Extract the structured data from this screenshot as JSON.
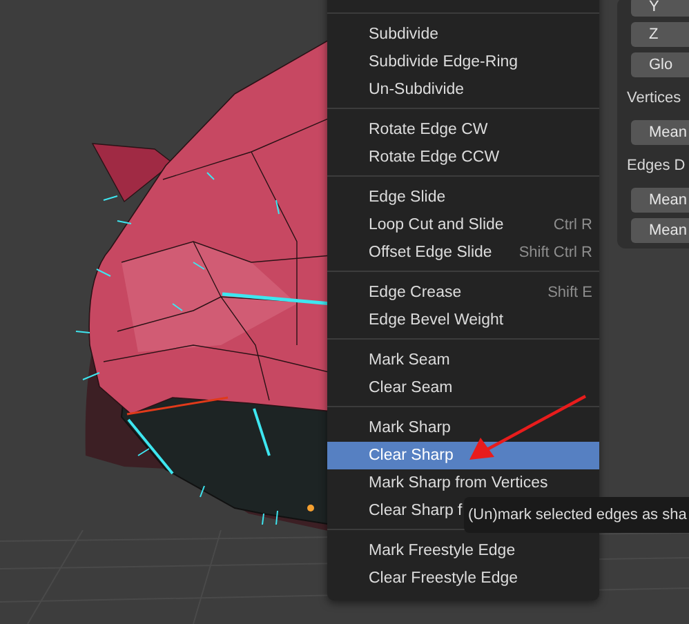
{
  "menu": {
    "sections": [
      {
        "items": [
          {
            "label": "Subdivide",
            "selected": false
          },
          {
            "label": "Subdivide Edge-Ring",
            "selected": false
          },
          {
            "label": "Un-Subdivide",
            "selected": false
          }
        ]
      },
      {
        "items": [
          {
            "label": "Rotate Edge CW",
            "selected": false
          },
          {
            "label": "Rotate Edge CCW",
            "selected": false
          }
        ]
      },
      {
        "items": [
          {
            "label": "Edge Slide",
            "selected": false
          },
          {
            "label": "Loop Cut and Slide",
            "shortcut": "Ctrl R",
            "selected": false
          },
          {
            "label": "Offset Edge Slide",
            "shortcut": "Shift Ctrl R",
            "selected": false
          }
        ]
      },
      {
        "items": [
          {
            "label": "Edge Crease",
            "shortcut": "Shift E",
            "selected": false
          },
          {
            "label": "Edge Bevel Weight",
            "selected": false
          }
        ]
      },
      {
        "items": [
          {
            "label": "Mark Seam",
            "selected": false
          },
          {
            "label": "Clear Seam",
            "selected": false
          }
        ]
      },
      {
        "items": [
          {
            "label": "Mark Sharp",
            "selected": false
          },
          {
            "label": "Clear Sharp",
            "selected": true
          },
          {
            "label": "Mark Sharp from Vertices",
            "selected": false
          },
          {
            "label": "Clear Sharp f",
            "selected": false
          }
        ]
      },
      {
        "items": [
          {
            "label": "Mark Freestyle Edge",
            "selected": false
          },
          {
            "label": "Clear Freestyle Edge",
            "selected": false
          }
        ]
      }
    ]
  },
  "tooltip": {
    "text": "(Un)mark selected edges as sha"
  },
  "side_panel": {
    "items": [
      {
        "kind": "button",
        "label": "Y"
      },
      {
        "kind": "button",
        "label": "Z"
      },
      {
        "kind": "button",
        "label": "Glo"
      },
      {
        "kind": "label",
        "label": "Vertices"
      },
      {
        "kind": "button",
        "label": "Mean"
      },
      {
        "kind": "label",
        "label": "Edges D"
      },
      {
        "kind": "button",
        "label": "Mean"
      },
      {
        "kind": "button",
        "label": "Mean"
      }
    ]
  }
}
